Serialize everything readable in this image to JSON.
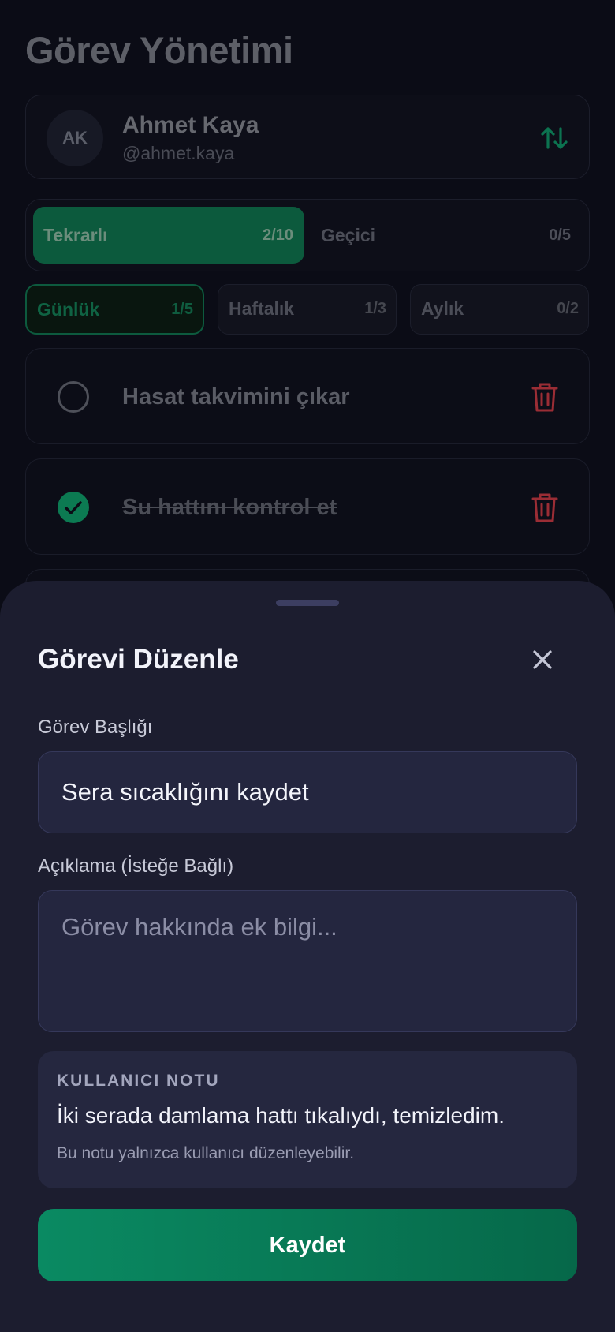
{
  "app": {
    "title": "Görev Yönetimi"
  },
  "user": {
    "initials": "AK",
    "name": "Ahmet Kaya",
    "handle": "@ahmet.kaya"
  },
  "segments": [
    {
      "label": "Tekrarlı",
      "count": "2/10",
      "active": true
    },
    {
      "label": "Geçici",
      "count": "0/5",
      "active": false
    }
  ],
  "periods": [
    {
      "label": "Günlük",
      "count": "1/5",
      "active": true
    },
    {
      "label": "Haftalık",
      "count": "1/3",
      "active": false
    },
    {
      "label": "Aylık",
      "count": "0/2",
      "active": false
    }
  ],
  "tasks": [
    {
      "title": "Hasat takvimini çıkar",
      "done": false
    },
    {
      "title": "Su hattını kontrol et",
      "done": true
    }
  ],
  "sheet": {
    "title": "Görevi Düzenle",
    "title_label": "Görev Başlığı",
    "title_value": "Sera sıcaklığını kaydet",
    "desc_label": "Açıklama (İsteğe Bağlı)",
    "desc_placeholder": "Görev hakkında ek bilgi...",
    "note": {
      "title": "KULLANICI NOTU",
      "text": "İki serada damlama hattı tıkalıydı, temizledim.",
      "hint": "Bu notu yalnızca kullanıcı düzenleyebilir."
    },
    "save_label": "Kaydet"
  },
  "colors": {
    "accent": "#0a8a62",
    "danger": "#9b2d35",
    "sheet_bg": "#1c1d2f",
    "page_bg": "#0b0c16"
  },
  "icons": {
    "sort": "sort-arrows-icon",
    "trash": "trash-icon",
    "check": "check-icon",
    "close": "close-icon"
  }
}
